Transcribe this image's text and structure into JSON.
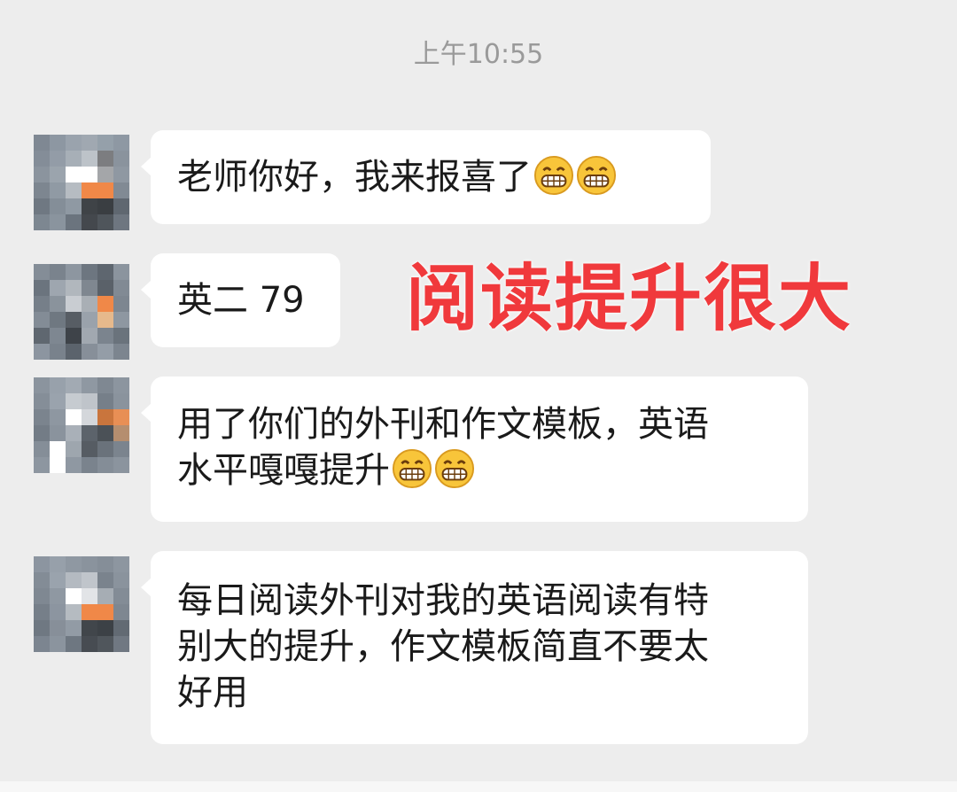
{
  "chat": {
    "timestamp": "上午10:55",
    "overlay_caption": "阅读提升很大",
    "messages": [
      {
        "text": "老师你好，我来报喜了",
        "emoji_count": 2
      },
      {
        "text": "英二 79",
        "emoji_count": 0
      },
      {
        "line1": "用了你们的外刊和作文模板，英语",
        "line2": "水平嘎嘎提升",
        "emoji_count": 2
      },
      {
        "line1": "每日阅读外刊对我的英语阅读有特",
        "line2": "别大的提升，作文模板简直不要太",
        "line3": "好用",
        "emoji_count": 0
      }
    ]
  },
  "colors": {
    "background": "#ededed",
    "bubble": "#ffffff",
    "timestamp_text": "#9a9a9a",
    "overlay_caption": "#f0393c"
  },
  "icons": {
    "emoji": "grinning-face-emoji-icon",
    "avatar": "pixelated-avatar"
  }
}
